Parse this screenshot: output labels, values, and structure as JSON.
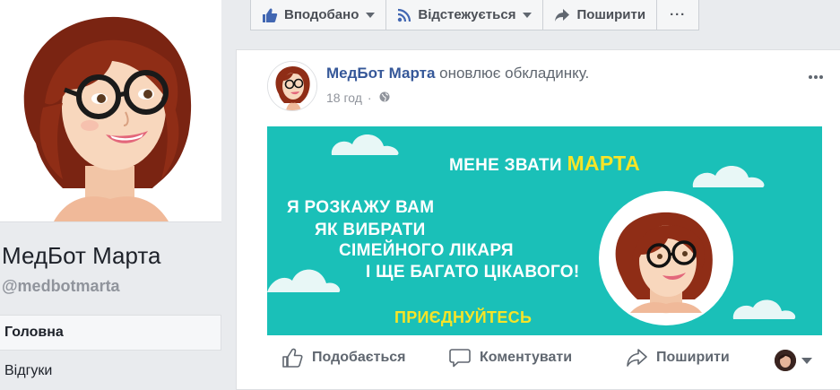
{
  "sidebar": {
    "page_name": "МедБот Марта",
    "handle": "@medbotmarta",
    "nav_items": [
      {
        "label": "Головна",
        "active": true
      },
      {
        "label": "Відгуки",
        "active": false
      }
    ]
  },
  "action_bar": {
    "like_label": "Вподобано",
    "follow_label": "Відстежується",
    "share_label": "Поширити",
    "more_label": "···"
  },
  "post": {
    "author": "МедБот Марта",
    "action_text": " оновлює обкладинку.",
    "time": "18 год",
    "separator": "·",
    "cover": {
      "line1_prefix": "МЕНЕ ЗВАТИ ",
      "line1_name": "МАРТА",
      "line2": "Я РОЗКАЖУ ВАМ",
      "line3": "ЯК ВИБРАТИ",
      "line4": "СІМЕЙНОГО ЛІКАРЯ",
      "line5": "І ЩЕ БАГАТО ЦІКАВОГО!",
      "cta": "ПРИЄДНУЙТЕСЬ"
    },
    "actions": {
      "like": "Подобається",
      "comment": "Коментувати",
      "share": "Поширити"
    }
  },
  "colors": {
    "fb_blue": "#365899",
    "cover_teal": "#1ac0b8",
    "cover_yellow": "#f7e427",
    "page_bg": "#e9ebee"
  },
  "icons": [
    "thumbs-up-icon",
    "rss-icon",
    "share-arrow-icon",
    "more-dots-icon",
    "globe-icon",
    "comment-icon"
  ]
}
